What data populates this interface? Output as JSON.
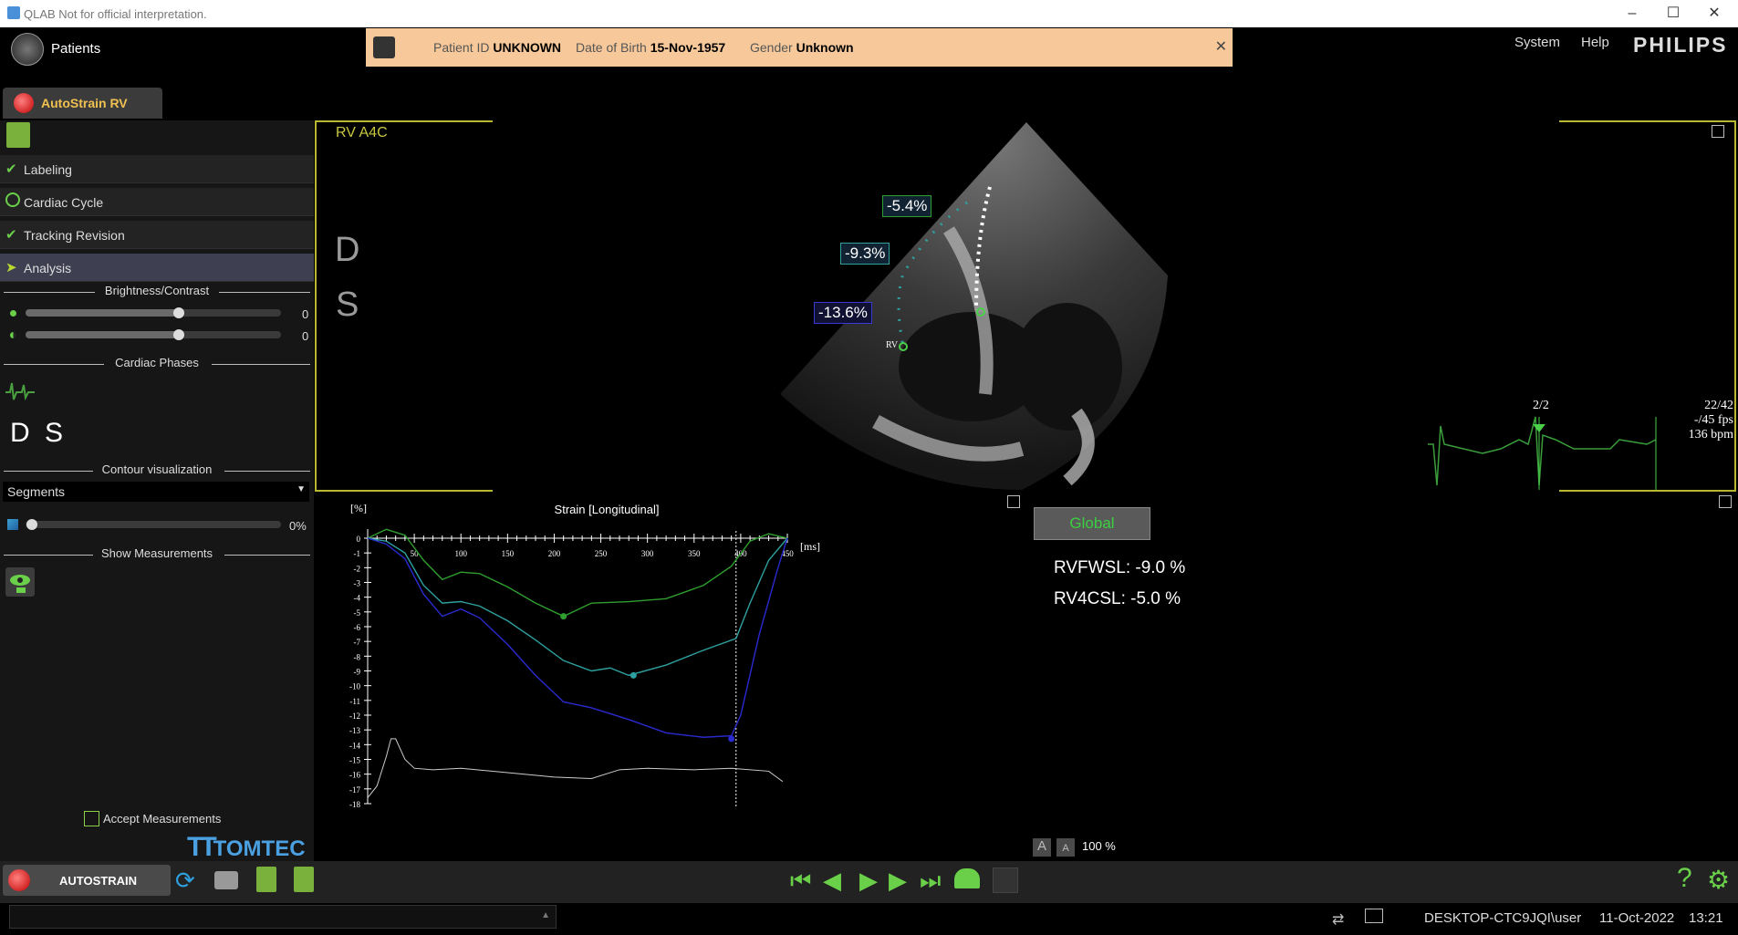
{
  "window": {
    "title": "QLAB Not for official interpretation."
  },
  "header": {
    "patients_label": "Patients",
    "patient_banner": {
      "id_label": "Patient ID",
      "id_value": "UNKNOWN",
      "dob_label": "Date of Birth",
      "dob_value": "15-Nov-1957",
      "gender_label": "Gender",
      "gender_value": "Unknown"
    },
    "menu": {
      "system": "System",
      "help": "Help"
    },
    "brand": "PHILIPS",
    "tab_label": "AutoStrain RV"
  },
  "workflow": {
    "steps": [
      {
        "label": "Labeling",
        "state": "done"
      },
      {
        "label": "Cardiac Cycle",
        "state": "pending"
      },
      {
        "label": "Tracking Revision",
        "state": "done"
      },
      {
        "label": "Analysis",
        "state": "active"
      }
    ],
    "brightness_contrast_title": "Brightness/Contrast",
    "brightness_value": "0",
    "contrast_value": "0",
    "brightness_level": 0.6,
    "contrast_level": 0.6,
    "cardiac_phases_title": "Cardiac Phases",
    "phase_d": "D",
    "phase_s": "S",
    "contour_title": "Contour visualization",
    "contour_option": "Segments",
    "contour_opacity": "0%",
    "show_measurements_title": "Show Measurements",
    "accept_measurements": "Accept Measurements",
    "vendor_logo": "TOMTEC"
  },
  "viewer": {
    "view_label": "RV A4C",
    "side_d": "D",
    "side_s": "S",
    "segment_labels": [
      "-5.4%",
      "-9.3%",
      "-13.6%"
    ],
    "rv_label": "RV",
    "ecg_frame": "2/2",
    "frame_info": [
      "22/42",
      "-/45 fps",
      "136 bpm"
    ]
  },
  "results": {
    "global_button": "Global",
    "measurements": [
      "RVFWSL: -9.0 %",
      "RV4CSL: -5.0 %"
    ],
    "zoom": "100 %",
    "font_small_a": "A",
    "font_large_a": "A"
  },
  "chart_data": {
    "type": "line",
    "title": "Strain [Longitudinal]",
    "ylabel": "[%]",
    "xlabel": "[ms]",
    "xlim": [
      0,
      450
    ],
    "ylim": [
      -18,
      0
    ],
    "x_ticks": [
      "50",
      "100",
      "150",
      "200",
      "250",
      "300",
      "350",
      "400",
      "450"
    ],
    "y_ticks": [
      "0",
      "-1",
      "-2",
      "-3",
      "-4",
      "-5",
      "-6",
      "-7",
      "-8",
      "-9",
      "-10",
      "-11",
      "-12",
      "-13",
      "-14",
      "-15",
      "-16",
      "-17",
      "-18"
    ],
    "x_marker": 395,
    "series": [
      {
        "color": "#2e9e2e",
        "x": [
          0,
          20,
          40,
          60,
          80,
          100,
          120,
          150,
          180,
          210,
          240,
          280,
          320,
          360,
          390,
          410,
          430,
          450
        ],
        "y": [
          0,
          0.6,
          0.2,
          -1.5,
          -2.8,
          -2.3,
          -2.4,
          -3.3,
          -4.4,
          -5.3,
          -4.4,
          -4.3,
          -4.1,
          -3.2,
          -1.9,
          -0.2,
          0.3,
          0
        ],
        "peak": [
          210,
          -5.3
        ]
      },
      {
        "color": "#2ea0a0",
        "x": [
          0,
          20,
          40,
          60,
          80,
          100,
          120,
          150,
          180,
          210,
          240,
          260,
          280,
          320,
          360,
          395,
          410,
          430,
          450
        ],
        "y": [
          0,
          -0.2,
          -1.0,
          -3.2,
          -4.4,
          -4.3,
          -4.6,
          -5.6,
          -6.9,
          -8.3,
          -9.0,
          -8.8,
          -9.3,
          -8.6,
          -7.6,
          -6.8,
          -4.4,
          -1.5,
          0
        ],
        "peak": [
          285,
          -9.3
        ]
      },
      {
        "color": "#2a2ad0",
        "x": [
          0,
          20,
          40,
          60,
          80,
          100,
          120,
          150,
          180,
          210,
          240,
          280,
          320,
          360,
          390,
          400,
          420,
          440,
          450
        ],
        "y": [
          0,
          -0.4,
          -1.4,
          -3.8,
          -5.3,
          -4.8,
          -5.4,
          -7.2,
          -9.3,
          -11.1,
          -11.5,
          -12.3,
          -13.2,
          -13.5,
          -13.4,
          -12.0,
          -6.5,
          -2.0,
          0
        ],
        "peak": [
          390,
          -13.6
        ]
      }
    ],
    "ecg_trace": {
      "color": "#cccccc",
      "x": [
        0,
        10,
        20,
        25,
        30,
        40,
        50,
        70,
        100,
        150,
        200,
        240,
        270,
        300,
        350,
        390,
        430,
        445
      ],
      "y": [
        -17.6,
        -16.8,
        -14.8,
        -13.6,
        -13.6,
        -15.0,
        -15.6,
        -15.7,
        -15.6,
        -15.9,
        -16.2,
        -16.3,
        -15.7,
        -15.6,
        -15.7,
        -15.6,
        -15.8,
        -16.5
      ]
    }
  }
}
